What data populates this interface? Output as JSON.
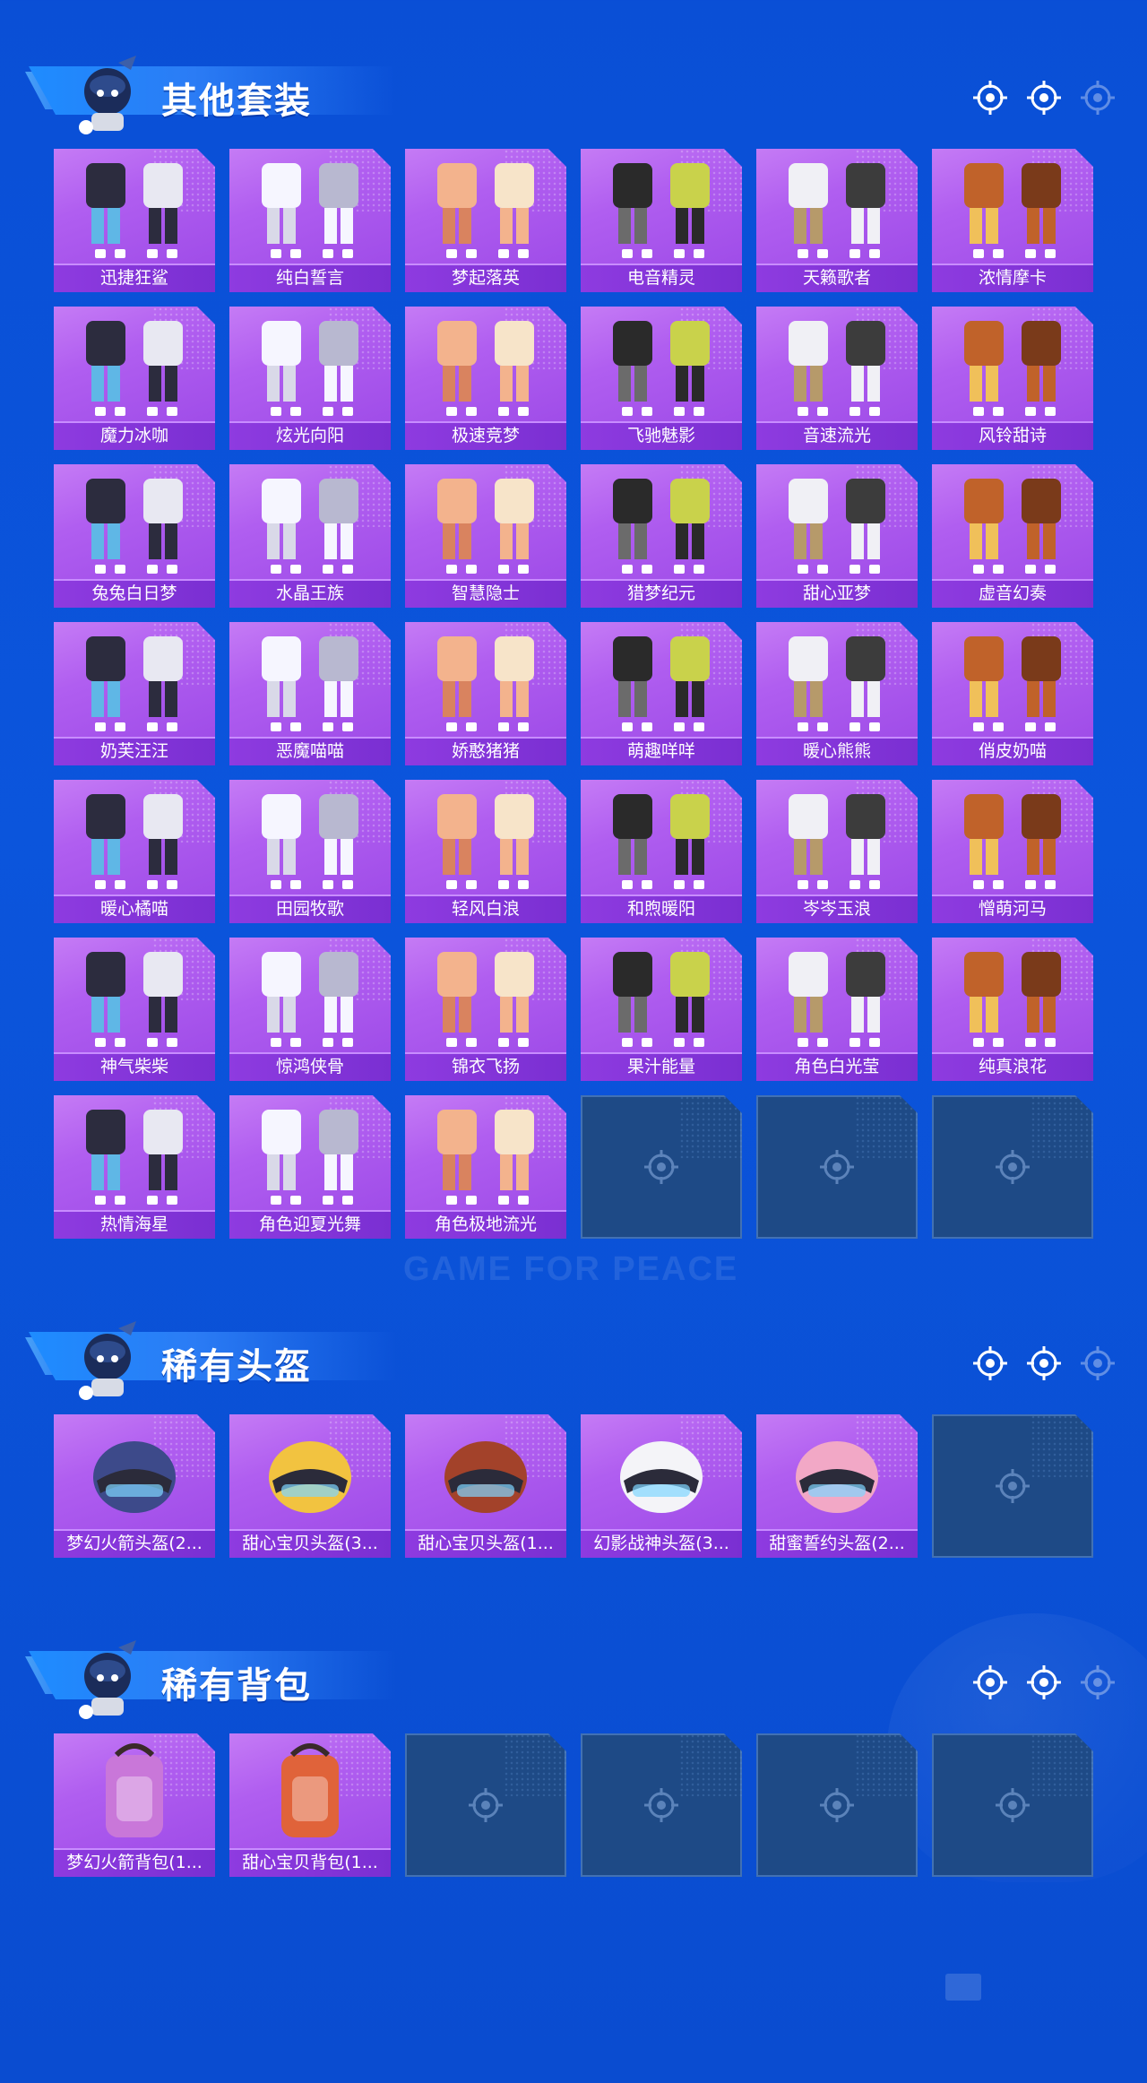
{
  "background": {
    "watermark_text": "GAME FOR PEACE",
    "accent_color": "#0a4fd6"
  },
  "sections": [
    {
      "title": "其他套装",
      "icon": "target-icon",
      "items": [
        "迅捷狂鲨",
        "纯白誓言",
        "梦起落英",
        "电音精灵",
        "天籁歌者",
        "浓情摩卡",
        "魔力冰咖",
        "炫光向阳",
        "极速竞梦",
        "飞驰魅影",
        "音速流光",
        "风铃甜诗",
        "兔兔白日梦",
        "水晶王族",
        "智慧隐士",
        "猎梦纪元",
        "甜心亚梦",
        "虚音幻奏",
        "奶芙汪汪",
        "恶魔喵喵",
        "娇憨猪猪",
        "萌趣咩咩",
        "暖心熊熊",
        "俏皮奶喵",
        "暖心橘喵",
        "田园牧歌",
        "轻风白浪",
        "和煦暖阳",
        "岑岑玉浪",
        "憎萌河马",
        "神气柴柴",
        "惊鸿侠骨",
        "锦衣飞扬",
        "果汁能量",
        "角色白光莹",
        "纯真浪花",
        "热情海星",
        "角色迎夏光舞",
        "角色极地流光"
      ],
      "empty_slots": 3
    },
    {
      "title": "稀有头盔",
      "icon": "target-icon",
      "items": [
        "梦幻火箭头盔(2...",
        "甜心宝贝头盔(3...",
        "甜心宝贝头盔(1...",
        "幻影战神头盔(3...",
        "甜蜜誓约头盔(2..."
      ],
      "empty_slots": 1
    },
    {
      "title": "稀有背包",
      "icon": "target-icon",
      "items": [
        "梦幻火箭背包(1...",
        "甜心宝贝背包(1..."
      ],
      "empty_slots": 4
    }
  ]
}
